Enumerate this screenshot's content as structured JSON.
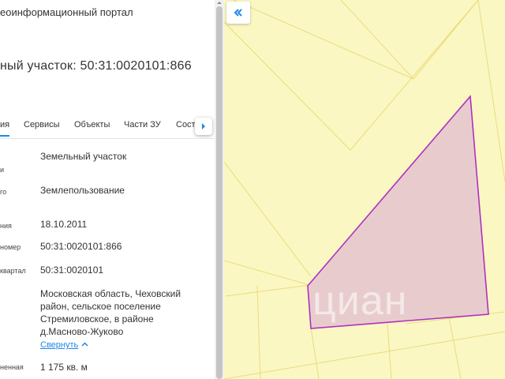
{
  "header": {
    "portal_title": "еоинформационный портал",
    "page_title": "ный участок: 50:31:0020101:866"
  },
  "tabs": [
    {
      "label": "ия",
      "active": true
    },
    {
      "label": "Сервисы",
      "active": false
    },
    {
      "label": "Объекты",
      "active": false
    },
    {
      "label": "Части ЗУ",
      "active": false
    },
    {
      "label": "Соста",
      "active": false
    }
  ],
  "tabs_scroll_icon": "chevron-right-icon",
  "rows": [
    {
      "label": "и",
      "value": "Земельный участок"
    },
    {
      "label": "го",
      "value": "Землепользование"
    },
    {
      "label": "ния",
      "value": "18.10.2011"
    },
    {
      "label": "номер",
      "value": "50:31:0020101:866"
    },
    {
      "label": "квартал",
      "value": "50:31:0020101"
    },
    {
      "label": "",
      "value": "Московская область, Чеховский район, сельское поселение Стремиловское, в районе д.Масново-Жуково"
    },
    {
      "label": "ненная",
      "value": "1 175 кв. м"
    }
  ],
  "collapse_link": "Свернуть",
  "map": {
    "collapse_icon": "double-chevron-left-icon",
    "watermark": "циан",
    "colors": {
      "background": "#fbf7c3",
      "parcel_lines": "#e9dc7a",
      "parcel_fill": "#e8cccd",
      "parcel_outline": "#b030c0",
      "accent": "#1e88e5"
    }
  }
}
